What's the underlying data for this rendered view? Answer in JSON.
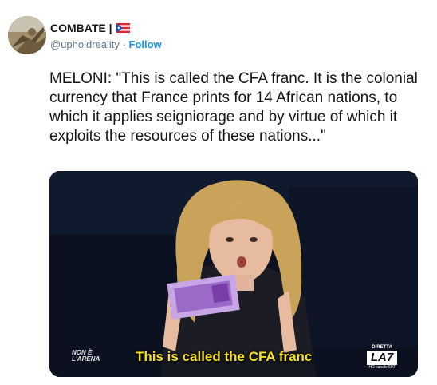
{
  "author": {
    "display_name": "COMBATE |",
    "handle": "@upholdreality",
    "separator": "·",
    "follow_label": "Follow"
  },
  "tweet": {
    "text": "MELONI: \"This is called the CFA franc. It is the colonial currency that France prints for 14 African nations, to which it applies seigniorage and by virtue of which it exploits the resources of these nations...\""
  },
  "media": {
    "subtitle": "This is called the CFA franc",
    "logo_left": [
      "NON È",
      "L'ARENA"
    ],
    "logo_right_top": "DIRETTA",
    "logo_right_mark": "LA7",
    "logo_right_channel": "HD canale 507",
    "subtitle_color": "#f5e21b"
  },
  "colors": {
    "link": "#1b95e0",
    "text": "#14171a",
    "secondary": "#657786"
  }
}
